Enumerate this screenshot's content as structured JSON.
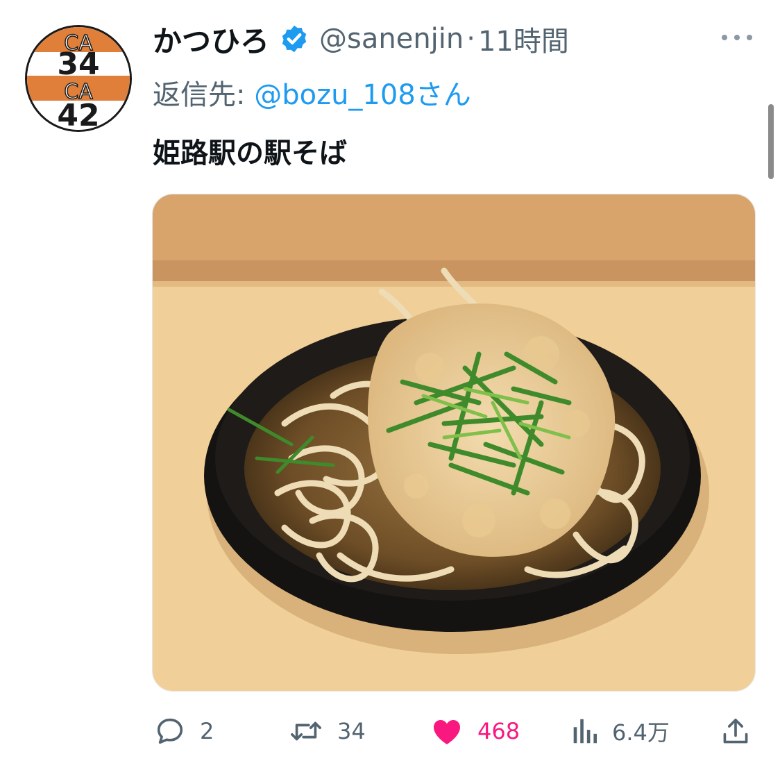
{
  "tweet": {
    "display_name": "かつひろ",
    "handle": "@sanenjin",
    "separator": "·",
    "time": "11時間",
    "reply_prefix": "返信先: ",
    "reply_to": "@bozu_108さん",
    "text": "姫路駅の駅そば",
    "avatar": {
      "lines": [
        "CA",
        "34",
        "CA",
        "42"
      ]
    }
  },
  "actions": {
    "reply_count": "2",
    "retweet_count": "34",
    "like_count": "468",
    "views_count": "6.4万"
  },
  "icons": {
    "verified": "verified-badge-icon",
    "more": "more-icon",
    "reply": "reply-icon",
    "retweet": "retweet-icon",
    "like": "heart-icon",
    "views": "views-icon",
    "share": "share-icon"
  },
  "colors": {
    "accent": "#1d9bf0",
    "like": "#f91880",
    "secondary_text": "#536471",
    "avatar_orange": "#e07f3a"
  }
}
